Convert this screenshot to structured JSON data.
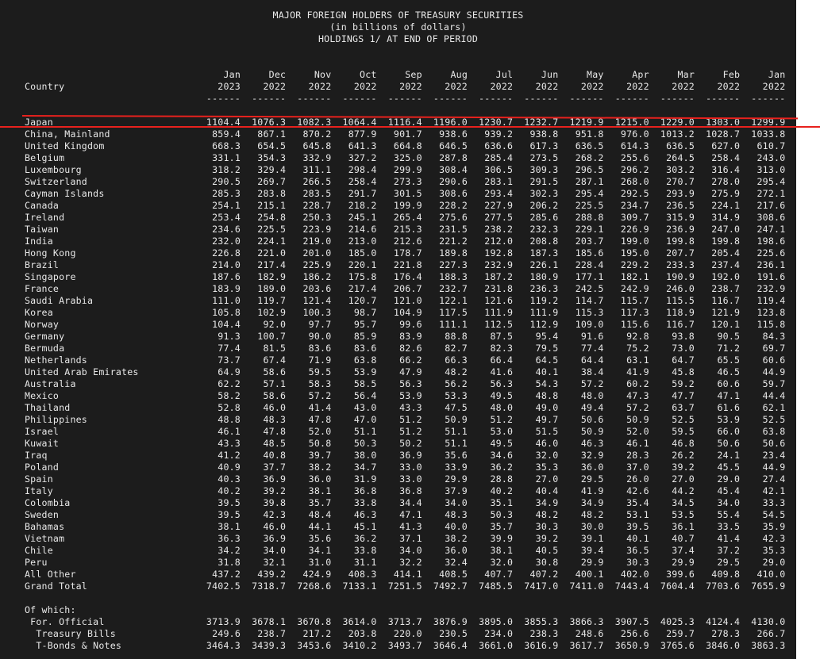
{
  "title": {
    "line1": "MAJOR FOREIGN HOLDERS OF TREASURY SECURITIES",
    "line2": "(in billions of dollars)",
    "line3": "HOLDINGS 1/ AT END OF PERIOD"
  },
  "country_header": "Country",
  "columns": [
    {
      "month": "Jan",
      "year": "2023"
    },
    {
      "month": "Dec",
      "year": "2022"
    },
    {
      "month": "Nov",
      "year": "2022"
    },
    {
      "month": "Oct",
      "year": "2022"
    },
    {
      "month": "Sep",
      "year": "2022"
    },
    {
      "month": "Aug",
      "year": "2022"
    },
    {
      "month": "Jul",
      "year": "2022"
    },
    {
      "month": "Jun",
      "year": "2022"
    },
    {
      "month": "May",
      "year": "2022"
    },
    {
      "month": "Apr",
      "year": "2022"
    },
    {
      "month": "Mar",
      "year": "2022"
    },
    {
      "month": "Feb",
      "year": "2022"
    },
    {
      "month": "Jan",
      "year": "2022"
    }
  ],
  "rule": "------",
  "rows": [
    {
      "country": "Japan",
      "values": [
        "1104.4",
        "1076.3",
        "1082.3",
        "1064.4",
        "1116.4",
        "1196.0",
        "1230.7",
        "1232.7",
        "1219.9",
        "1215.0",
        "1229.0",
        "1303.0",
        "1299.9"
      ]
    },
    {
      "country": "China, Mainland",
      "values": [
        "859.4",
        "867.1",
        "870.2",
        "877.9",
        "901.7",
        "938.6",
        "939.2",
        "938.8",
        "951.8",
        "976.0",
        "1013.2",
        "1028.7",
        "1033.8"
      ]
    },
    {
      "country": "United Kingdom",
      "values": [
        "668.3",
        "654.5",
        "645.8",
        "641.3",
        "664.8",
        "646.5",
        "636.6",
        "617.3",
        "636.5",
        "614.3",
        "636.5",
        "627.0",
        "610.7"
      ]
    },
    {
      "country": "Belgium",
      "values": [
        "331.1",
        "354.3",
        "332.9",
        "327.2",
        "325.0",
        "287.8",
        "285.4",
        "273.5",
        "268.2",
        "255.6",
        "264.5",
        "258.4",
        "243.0"
      ]
    },
    {
      "country": "Luxembourg",
      "values": [
        "318.2",
        "329.4",
        "311.1",
        "298.4",
        "299.9",
        "308.4",
        "306.5",
        "309.3",
        "296.5",
        "296.2",
        "303.2",
        "316.4",
        "313.0"
      ]
    },
    {
      "country": "Switzerland",
      "values": [
        "290.5",
        "269.7",
        "266.5",
        "258.4",
        "273.3",
        "290.6",
        "283.1",
        "291.5",
        "287.1",
        "268.0",
        "270.7",
        "278.0",
        "295.4"
      ]
    },
    {
      "country": "Cayman Islands",
      "values": [
        "285.3",
        "283.8",
        "283.5",
        "291.7",
        "301.5",
        "308.6",
        "293.4",
        "302.3",
        "295.4",
        "292.5",
        "293.9",
        "275.9",
        "272.1"
      ]
    },
    {
      "country": "Canada",
      "values": [
        "254.1",
        "215.1",
        "228.7",
        "218.2",
        "199.9",
        "228.2",
        "227.9",
        "206.2",
        "225.5",
        "234.7",
        "236.5",
        "224.1",
        "217.6"
      ]
    },
    {
      "country": "Ireland",
      "values": [
        "253.4",
        "254.8",
        "250.3",
        "245.1",
        "265.4",
        "275.6",
        "277.5",
        "285.6",
        "288.8",
        "309.7",
        "315.9",
        "314.9",
        "308.6"
      ]
    },
    {
      "country": "Taiwan",
      "values": [
        "234.6",
        "225.5",
        "223.9",
        "214.6",
        "215.3",
        "231.5",
        "238.2",
        "232.3",
        "229.1",
        "226.9",
        "236.9",
        "247.0",
        "247.1"
      ]
    },
    {
      "country": "India",
      "values": [
        "232.0",
        "224.1",
        "219.0",
        "213.0",
        "212.6",
        "221.2",
        "212.0",
        "208.8",
        "203.7",
        "199.0",
        "199.8",
        "199.8",
        "198.6"
      ]
    },
    {
      "country": "Hong Kong",
      "values": [
        "226.8",
        "221.0",
        "201.0",
        "185.0",
        "178.7",
        "189.8",
        "192.8",
        "187.3",
        "185.6",
        "195.0",
        "207.7",
        "205.4",
        "225.6"
      ]
    },
    {
      "country": "Brazil",
      "values": [
        "214.0",
        "217.4",
        "225.9",
        "220.1",
        "221.8",
        "227.3",
        "232.9",
        "226.1",
        "228.4",
        "229.2",
        "233.3",
        "237.4",
        "236.1"
      ]
    },
    {
      "country": "Singapore",
      "values": [
        "187.6",
        "182.9",
        "186.2",
        "175.8",
        "176.4",
        "188.3",
        "187.2",
        "180.9",
        "177.1",
        "182.1",
        "190.9",
        "192.0",
        "191.6"
      ]
    },
    {
      "country": "France",
      "values": [
        "183.9",
        "189.0",
        "203.6",
        "217.4",
        "206.7",
        "232.7",
        "231.8",
        "236.3",
        "242.5",
        "242.9",
        "246.0",
        "238.7",
        "232.9"
      ]
    },
    {
      "country": "Saudi Arabia",
      "values": [
        "111.0",
        "119.7",
        "121.4",
        "120.7",
        "121.0",
        "122.1",
        "121.6",
        "119.2",
        "114.7",
        "115.7",
        "115.5",
        "116.7",
        "119.4"
      ]
    },
    {
      "country": "Korea",
      "values": [
        "105.8",
        "102.9",
        "100.3",
        "98.7",
        "104.9",
        "117.5",
        "111.9",
        "111.9",
        "115.3",
        "117.3",
        "118.9",
        "121.9",
        "123.8"
      ]
    },
    {
      "country": "Norway",
      "values": [
        "104.4",
        "92.0",
        "97.7",
        "95.7",
        "99.6",
        "111.1",
        "112.5",
        "112.9",
        "109.0",
        "115.6",
        "116.7",
        "120.1",
        "115.8"
      ]
    },
    {
      "country": "Germany",
      "values": [
        "91.3",
        "100.7",
        "90.0",
        "85.9",
        "83.9",
        "88.8",
        "87.5",
        "95.4",
        "91.6",
        "92.8",
        "93.8",
        "90.5",
        "84.3"
      ]
    },
    {
      "country": "Bermuda",
      "values": [
        "77.4",
        "81.5",
        "83.6",
        "83.6",
        "82.6",
        "82.7",
        "82.3",
        "79.5",
        "77.4",
        "75.2",
        "73.0",
        "71.2",
        "69.7"
      ]
    },
    {
      "country": "Netherlands",
      "values": [
        "73.7",
        "67.4",
        "71.9",
        "63.8",
        "66.2",
        "66.3",
        "66.4",
        "64.5",
        "64.4",
        "63.1",
        "64.7",
        "65.5",
        "60.6"
      ]
    },
    {
      "country": "United Arab Emirates",
      "values": [
        "64.9",
        "58.6",
        "59.5",
        "53.9",
        "47.9",
        "48.2",
        "41.6",
        "40.1",
        "38.4",
        "41.9",
        "45.8",
        "46.5",
        "44.9"
      ]
    },
    {
      "country": "Australia",
      "values": [
        "62.2",
        "57.1",
        "58.3",
        "58.5",
        "56.3",
        "56.2",
        "56.3",
        "54.3",
        "57.2",
        "60.2",
        "59.2",
        "60.6",
        "59.7"
      ]
    },
    {
      "country": "Mexico",
      "values": [
        "58.2",
        "58.6",
        "57.2",
        "56.4",
        "53.9",
        "53.3",
        "49.5",
        "48.8",
        "48.0",
        "47.3",
        "47.7",
        "47.1",
        "44.4"
      ]
    },
    {
      "country": "Thailand",
      "values": [
        "52.8",
        "46.0",
        "41.4",
        "43.0",
        "43.3",
        "47.5",
        "48.0",
        "49.0",
        "49.4",
        "57.2",
        "63.7",
        "61.6",
        "62.1"
      ]
    },
    {
      "country": "Philippines",
      "values": [
        "48.8",
        "48.3",
        "47.8",
        "47.0",
        "51.2",
        "50.9",
        "51.2",
        "49.7",
        "50.6",
        "50.9",
        "52.5",
        "53.9",
        "52.5"
      ]
    },
    {
      "country": "Israel",
      "values": [
        "46.1",
        "47.8",
        "52.0",
        "51.1",
        "51.2",
        "51.1",
        "53.0",
        "51.5",
        "50.9",
        "52.0",
        "59.5",
        "66.0",
        "63.8"
      ]
    },
    {
      "country": "Kuwait",
      "values": [
        "43.3",
        "48.5",
        "50.8",
        "50.3",
        "50.2",
        "51.1",
        "49.5",
        "46.0",
        "46.3",
        "46.1",
        "46.8",
        "50.6",
        "50.6"
      ]
    },
    {
      "country": "Iraq",
      "values": [
        "41.2",
        "40.8",
        "39.7",
        "38.0",
        "36.9",
        "35.6",
        "34.6",
        "32.0",
        "32.9",
        "28.3",
        "26.2",
        "24.1",
        "23.4"
      ]
    },
    {
      "country": "Poland",
      "values": [
        "40.9",
        "37.7",
        "38.2",
        "34.7",
        "33.0",
        "33.9",
        "36.2",
        "35.3",
        "36.0",
        "37.0",
        "39.2",
        "45.5",
        "44.9"
      ]
    },
    {
      "country": "Spain",
      "values": [
        "40.3",
        "36.9",
        "36.0",
        "31.9",
        "33.0",
        "29.9",
        "28.8",
        "27.0",
        "29.5",
        "26.0",
        "27.0",
        "29.0",
        "27.4"
      ]
    },
    {
      "country": "Italy",
      "values": [
        "40.2",
        "39.2",
        "38.1",
        "36.8",
        "36.8",
        "37.9",
        "40.2",
        "40.4",
        "41.9",
        "42.6",
        "44.2",
        "45.4",
        "42.1"
      ]
    },
    {
      "country": "Colombia",
      "values": [
        "39.5",
        "39.8",
        "35.7",
        "33.8",
        "34.4",
        "34.0",
        "35.1",
        "34.9",
        "34.9",
        "35.4",
        "34.5",
        "34.0",
        "33.3"
      ]
    },
    {
      "country": "Sweden",
      "values": [
        "39.5",
        "42.3",
        "48.4",
        "46.3",
        "47.1",
        "48.3",
        "50.3",
        "48.2",
        "48.2",
        "53.1",
        "53.5",
        "55.4",
        "54.5"
      ]
    },
    {
      "country": "Bahamas",
      "values": [
        "38.1",
        "46.0",
        "44.1",
        "45.1",
        "41.3",
        "40.0",
        "35.7",
        "30.3",
        "30.0",
        "39.5",
        "36.1",
        "33.5",
        "35.9"
      ]
    },
    {
      "country": "Vietnam",
      "values": [
        "36.3",
        "36.9",
        "35.6",
        "36.2",
        "37.1",
        "38.2",
        "39.9",
        "39.2",
        "39.1",
        "40.1",
        "40.7",
        "41.4",
        "42.3"
      ]
    },
    {
      "country": "Chile",
      "values": [
        "34.2",
        "34.0",
        "34.1",
        "33.8",
        "34.0",
        "36.0",
        "38.1",
        "40.5",
        "39.4",
        "36.5",
        "37.4",
        "37.2",
        "35.3"
      ]
    },
    {
      "country": "Peru",
      "values": [
        "31.8",
        "32.1",
        "31.0",
        "31.1",
        "32.2",
        "32.4",
        "32.0",
        "30.8",
        "29.9",
        "30.3",
        "29.9",
        "29.5",
        "29.0"
      ]
    },
    {
      "country": "All Other",
      "values": [
        "437.2",
        "439.2",
        "424.9",
        "408.3",
        "414.1",
        "408.5",
        "407.7",
        "407.2",
        "400.1",
        "402.0",
        "399.6",
        "409.8",
        "410.0"
      ]
    },
    {
      "country": "Grand Total",
      "values": [
        "7402.5",
        "7318.7",
        "7268.6",
        "7133.1",
        "7251.5",
        "7492.7",
        "7485.5",
        "7417.0",
        "7411.0",
        "7443.4",
        "7604.4",
        "7703.6",
        "7655.9"
      ]
    }
  ],
  "of_which_label": "Of which:",
  "sub_rows": [
    {
      "country": " For. Official",
      "values": [
        "3713.9",
        "3678.1",
        "3670.8",
        "3614.0",
        "3713.7",
        "3876.9",
        "3895.0",
        "3855.3",
        "3866.3",
        "3907.5",
        "4025.3",
        "4124.4",
        "4130.0"
      ]
    },
    {
      "country": "  Treasury Bills",
      "values": [
        "249.6",
        "238.7",
        "217.2",
        "203.8",
        "220.0",
        "230.5",
        "234.0",
        "238.3",
        "248.6",
        "256.6",
        "259.7",
        "278.3",
        "266.7"
      ]
    },
    {
      "country": "  T-Bonds & Notes",
      "values": [
        "3464.3",
        "3439.3",
        "3453.6",
        "3410.2",
        "3493.7",
        "3646.4",
        "3661.0",
        "3616.9",
        "3617.7",
        "3650.9",
        "3765.6",
        "3846.0",
        "3863.3"
      ]
    }
  ],
  "highlight_color": "#e8211d"
}
